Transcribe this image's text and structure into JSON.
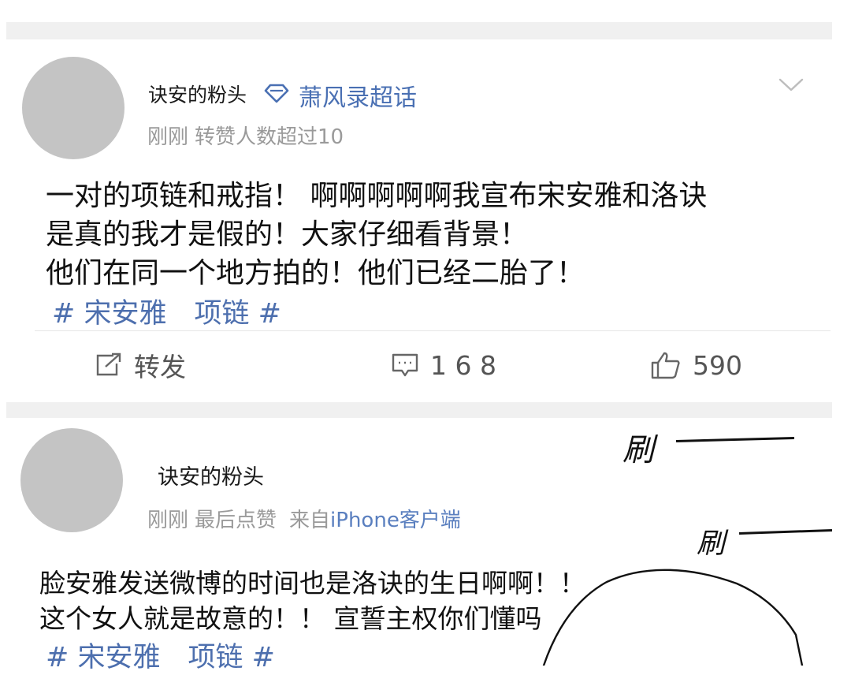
{
  "post1": {
    "username": "诀安的粉头",
    "supertopic": "萧风录超话",
    "meta_time": "刚刚",
    "meta_info": "转赞人数超过10",
    "body_lines": [
      "一对的项链和戒指！ 啊啊啊啊啊我宣布宋安雅和洛诀",
      "是真的我才是假的！大家仔细看背景！",
      "他们在同一个地方拍的！他们已经二胎了！"
    ],
    "tags": "# 宋安雅　项链 #",
    "actions": {
      "repost_label": "转发",
      "comment_count": "1 6 8",
      "like_count": "590"
    }
  },
  "post2": {
    "username": "诀安的粉头",
    "meta_time": "刚刚",
    "meta_info": "最后点赞",
    "meta_source_prefix": "来自",
    "meta_source": "iPhone客户端",
    "body_lines": [
      "脸安雅发送微博的时间也是洛诀的生日啊啊！！",
      "这个女人就是故意的！！ 宣誓主权你们懂吗"
    ],
    "tags": "# 宋安雅　项链 #"
  },
  "overlay": {
    "sfx_1": "刷",
    "sfx_2": "刷"
  },
  "icons": {
    "supertopic": "diamond-icon",
    "more": "chevron-down-icon",
    "repost": "share-icon",
    "comment": "comment-icon",
    "like": "thumbs-up-icon"
  },
  "colors": {
    "link": "#4a70b3",
    "meta": "#9a9a9a",
    "avatar": "#c4c4c4"
  }
}
